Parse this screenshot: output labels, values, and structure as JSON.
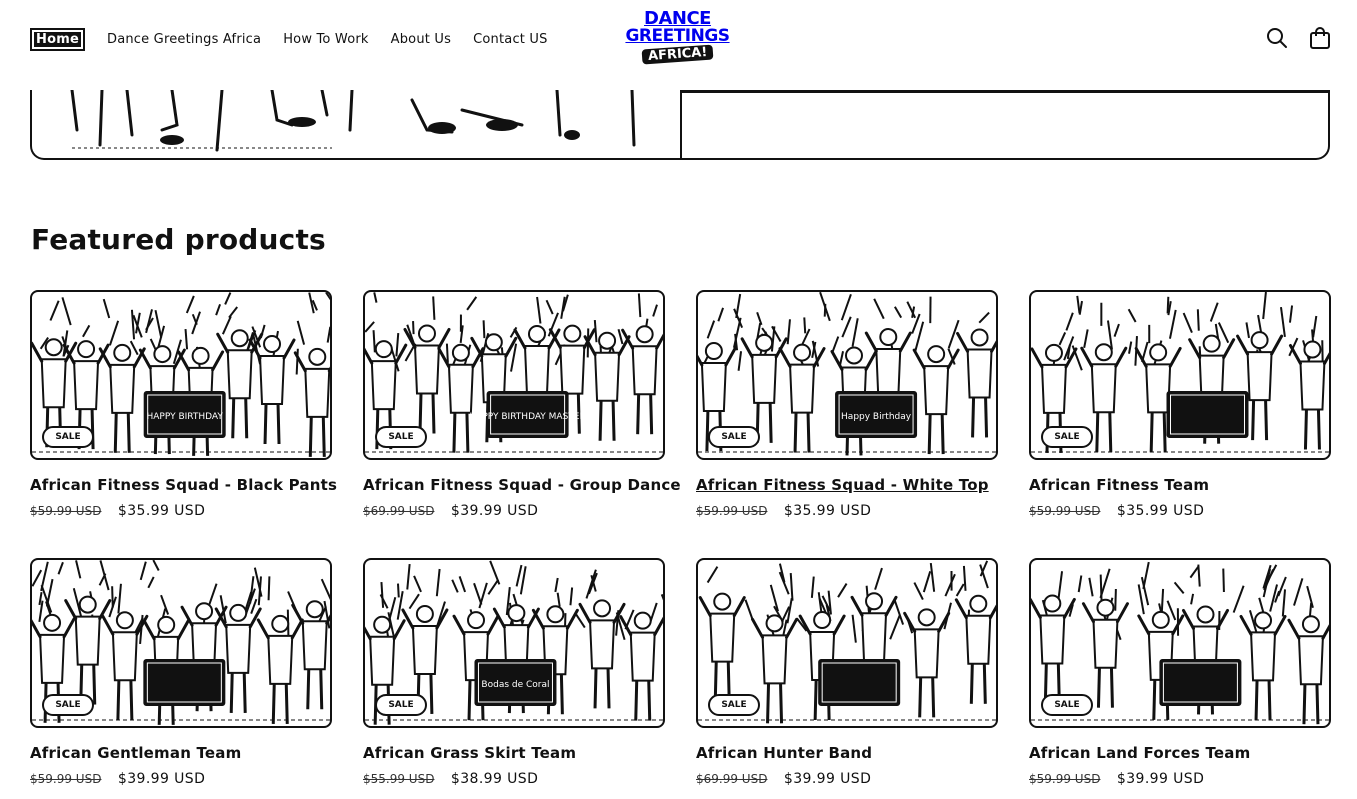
{
  "nav": {
    "home": "Home",
    "items": [
      "Dance Greetings Africa",
      "How To Work",
      "About Us",
      "Contact US"
    ]
  },
  "logo": {
    "line1": "DANCE",
    "line2": "GREETINGS",
    "line3": "AFRICA!"
  },
  "icons": {
    "search": "search-icon",
    "cart": "cart-icon"
  },
  "section": {
    "title": "Featured products"
  },
  "products": [
    {
      "title": "African Fitness Squad - Black Pants",
      "old_price": "$59.99 USD",
      "price": "$35.99 USD",
      "badge": "SALE",
      "sign": "HAPPY BIRTHDAY"
    },
    {
      "title": "African Fitness Squad - Group Dance",
      "old_price": "$69.99 USD",
      "price": "$39.99 USD",
      "badge": "SALE",
      "sign": "HAPPY BIRTHDAY MASTER"
    },
    {
      "title": "African Fitness Squad - White Top",
      "old_price": "$59.99 USD",
      "price": "$35.99 USD",
      "badge": "SALE",
      "sign": "Happy Birthday"
    },
    {
      "title": "African Fitness Team",
      "old_price": "$59.99 USD",
      "price": "$35.99 USD",
      "badge": "SALE",
      "sign": ""
    },
    {
      "title": "African Gentleman Team",
      "old_price": "$59.99 USD",
      "price": "$39.99 USD",
      "badge": "SALE",
      "sign": ""
    },
    {
      "title": "African Grass Skirt Team",
      "old_price": "$55.99 USD",
      "price": "$38.99 USD",
      "badge": "SALE",
      "sign": "Bodas de Coral"
    },
    {
      "title": "African Hunter Band",
      "old_price": "$69.99 USD",
      "price": "$39.99 USD",
      "badge": "SALE",
      "sign": ""
    },
    {
      "title": "African Land Forces Team",
      "old_price": "$59.99 USD",
      "price": "$39.99 USD",
      "badge": "SALE",
      "sign": ""
    }
  ]
}
